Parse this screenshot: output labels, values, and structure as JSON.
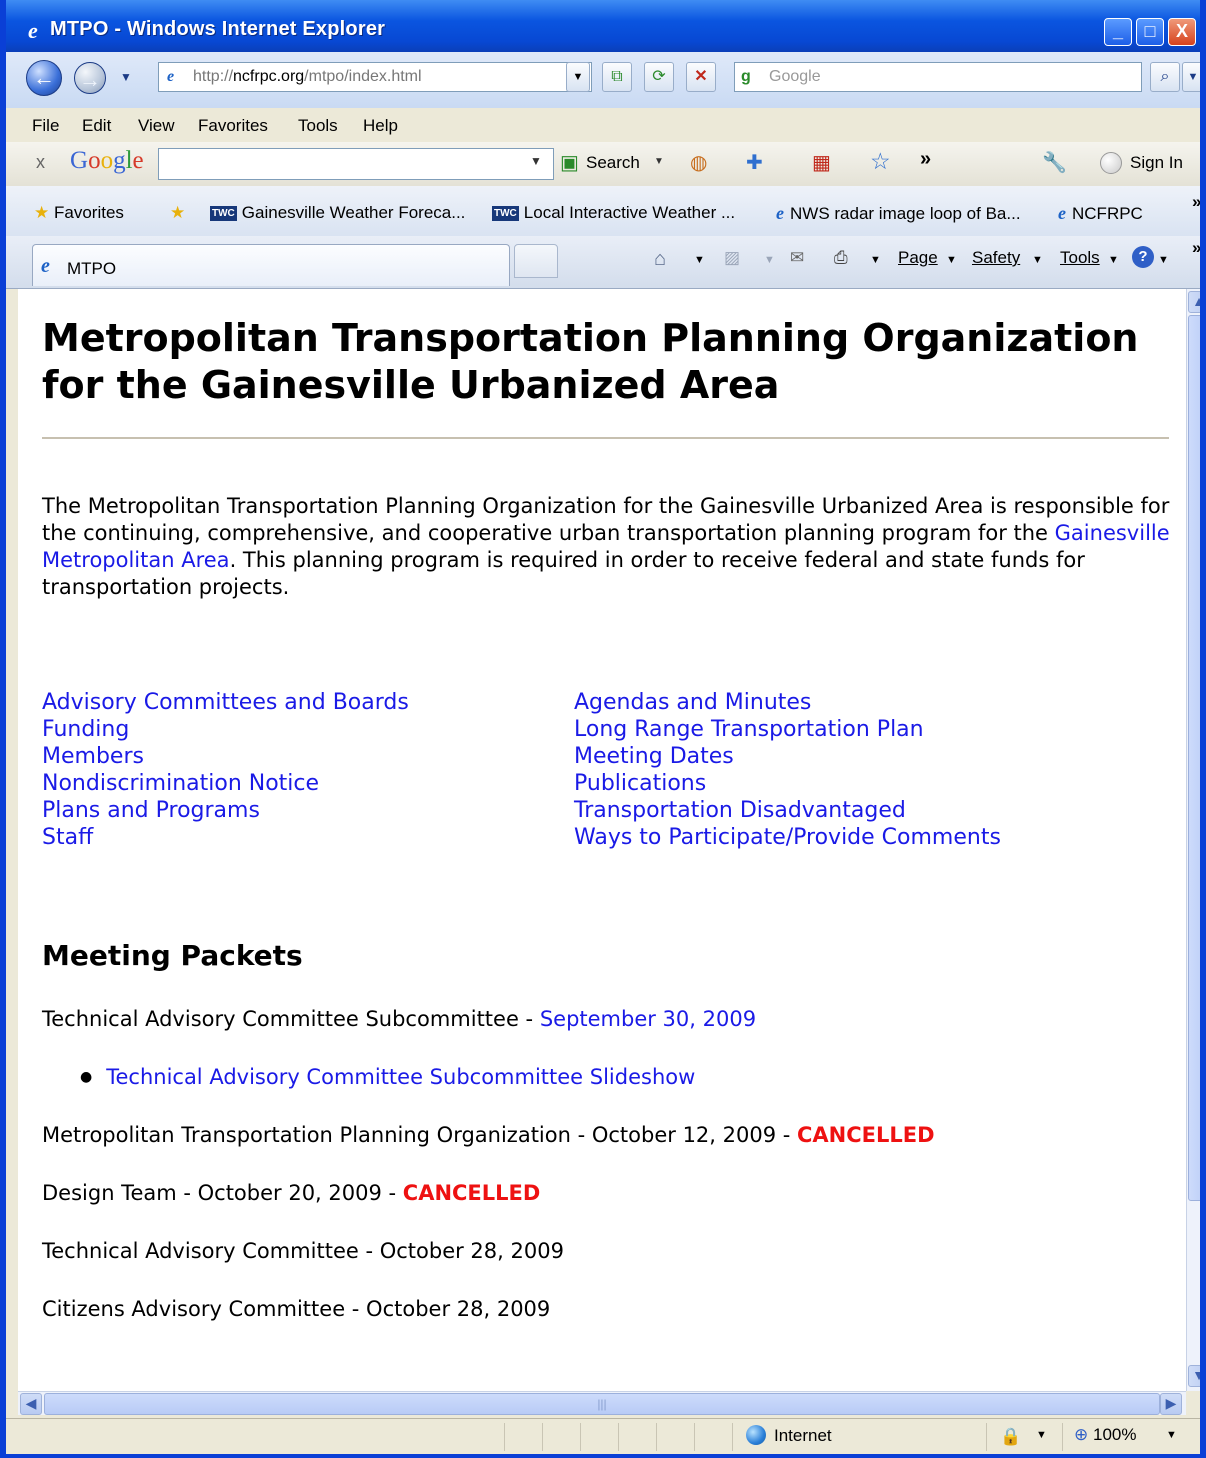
{
  "window": {
    "title": "MTPO - Windows Internet Explorer",
    "minimize_glyph": "_",
    "maximize_glyph": "□",
    "close_glyph": "X"
  },
  "address_bar": {
    "url_prefix": "http://",
    "url_host": "ncfrpc.org",
    "url_path": "/mtpo/index.html",
    "search_placeholder": "Google"
  },
  "menu": [
    "File",
    "Edit",
    "View",
    "Favorites",
    "Tools",
    "Help"
  ],
  "google_toolbar": {
    "logo": "Google",
    "close_glyph": "x",
    "search_label": "Search",
    "chevron": "»",
    "sign_in": "Sign In"
  },
  "favorites_bar": {
    "favorites_label": "Favorites",
    "items": [
      {
        "badge": "TWC",
        "label": "Gainesville Weather Foreca..."
      },
      {
        "badge": "TWC",
        "label": "Local Interactive Weather ..."
      },
      {
        "badge": "e",
        "label": "NWS radar image loop of Ba..."
      },
      {
        "badge": "e",
        "label": "NCFRPC"
      }
    ],
    "overflow": "»"
  },
  "tab": {
    "label": "MTPO"
  },
  "command_bar": {
    "page": "Page",
    "safety": "Safety",
    "tools": "Tools",
    "overflow": "»"
  },
  "page": {
    "heading": "Metropolitan Transportation Planning Organization for the Gainesville Urbanized Area",
    "intro_before_link": "The Metropolitan Transportation Planning Organization for the Gainesville Urbanized Area is responsible for the continuing, comprehensive, and cooperative urban transportation planning program for the ",
    "intro_link": "Gainesville Metropolitan Area",
    "intro_after_link": ". This planning program is required in order to receive federal and state funds for transportation projects.",
    "links_left": [
      "Advisory Committees and Boards",
      "Funding",
      "Members",
      "Nondiscrimination Notice",
      "Plans and Programs",
      "Staff"
    ],
    "links_right": [
      "Agendas and Minutes",
      "Long Range Transportation Plan",
      "Meeting Dates",
      "Publications",
      "Transportation Disadvantaged",
      "Ways to Participate/Provide Comments"
    ],
    "meeting_packets": {
      "heading": "Meeting Packets",
      "tacs_text": "Technical Advisory Committee Subcommittee - ",
      "tacs_link": "September 30, 2009",
      "tacs_bullet_link": "Technical Advisory Committee Subcommittee Slideshow",
      "mtpo_text": "Metropolitan Transportation Planning Organization - October 12, 2009 - ",
      "mtpo_status": "CANCELLED",
      "design_text": "Design Team - October 20, 2009 - ",
      "design_status": "CANCELLED",
      "tac_text": "Technical Advisory Committee - October 28, 2009",
      "cac_text": "Citizens Advisory Committee - October 28, 2009"
    }
  },
  "status_bar": {
    "zone": "Internet",
    "zoom": "100%"
  }
}
